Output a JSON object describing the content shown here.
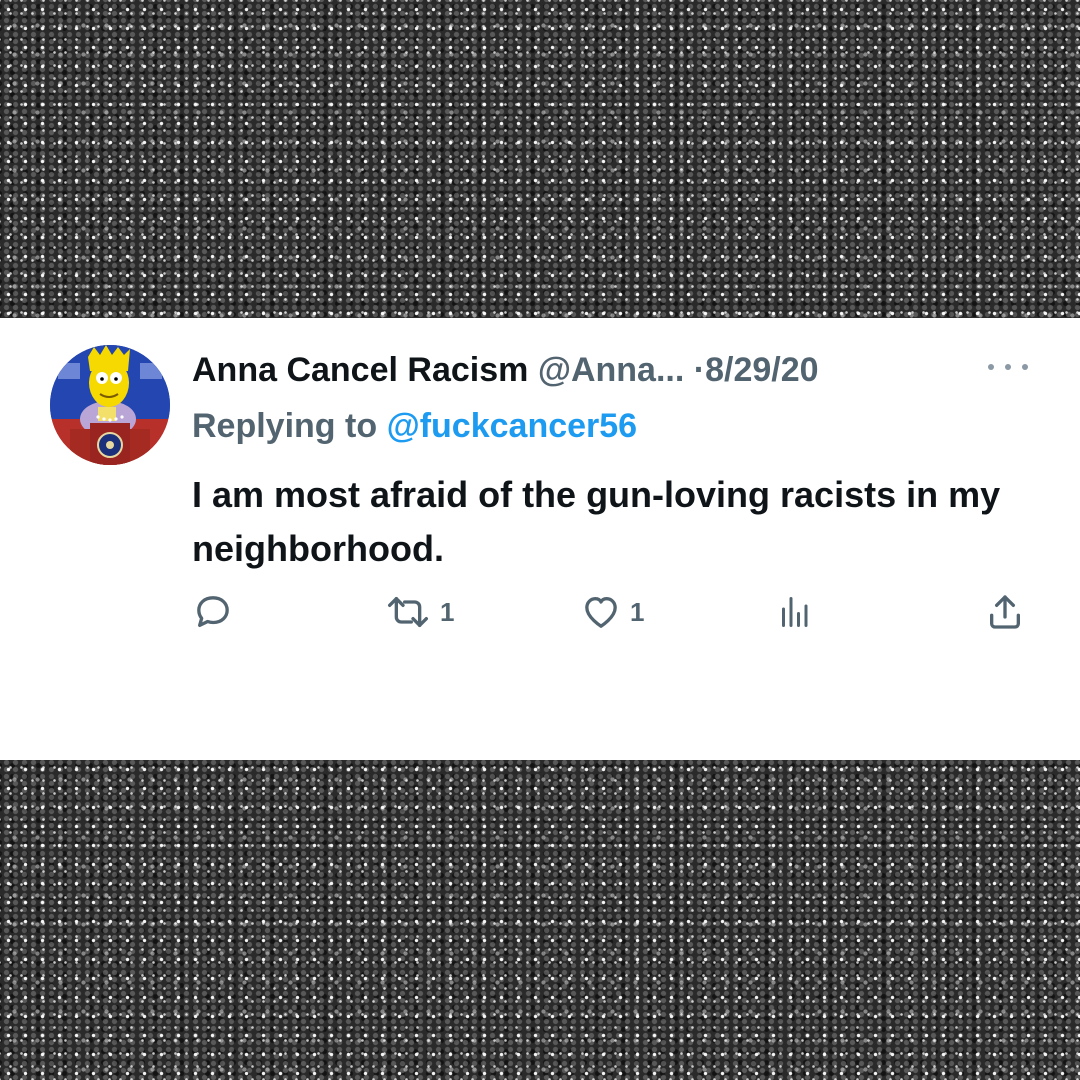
{
  "tweet": {
    "author_name": "Anna Cancel Racism",
    "handle": "@Anna...",
    "separator": "·",
    "date": "8/29/20",
    "reply_prefix": "Replying to",
    "reply_handle": "@fuckcancer56",
    "text": "I am most afraid of the gun-loving racists in my neighborhood."
  },
  "actions": {
    "reply_count": "",
    "retweet_count": "1",
    "like_count": "1"
  },
  "icons": [
    "avatar-image",
    "more-icon",
    "reply-icon",
    "retweet-icon",
    "like-icon",
    "views-icon",
    "share-icon"
  ],
  "colors": {
    "text_primary": "#0f1419",
    "text_secondary": "#536471",
    "link": "#1d9bf0",
    "card_bg": "#ffffff",
    "backdrop": "#2a2a2a"
  }
}
